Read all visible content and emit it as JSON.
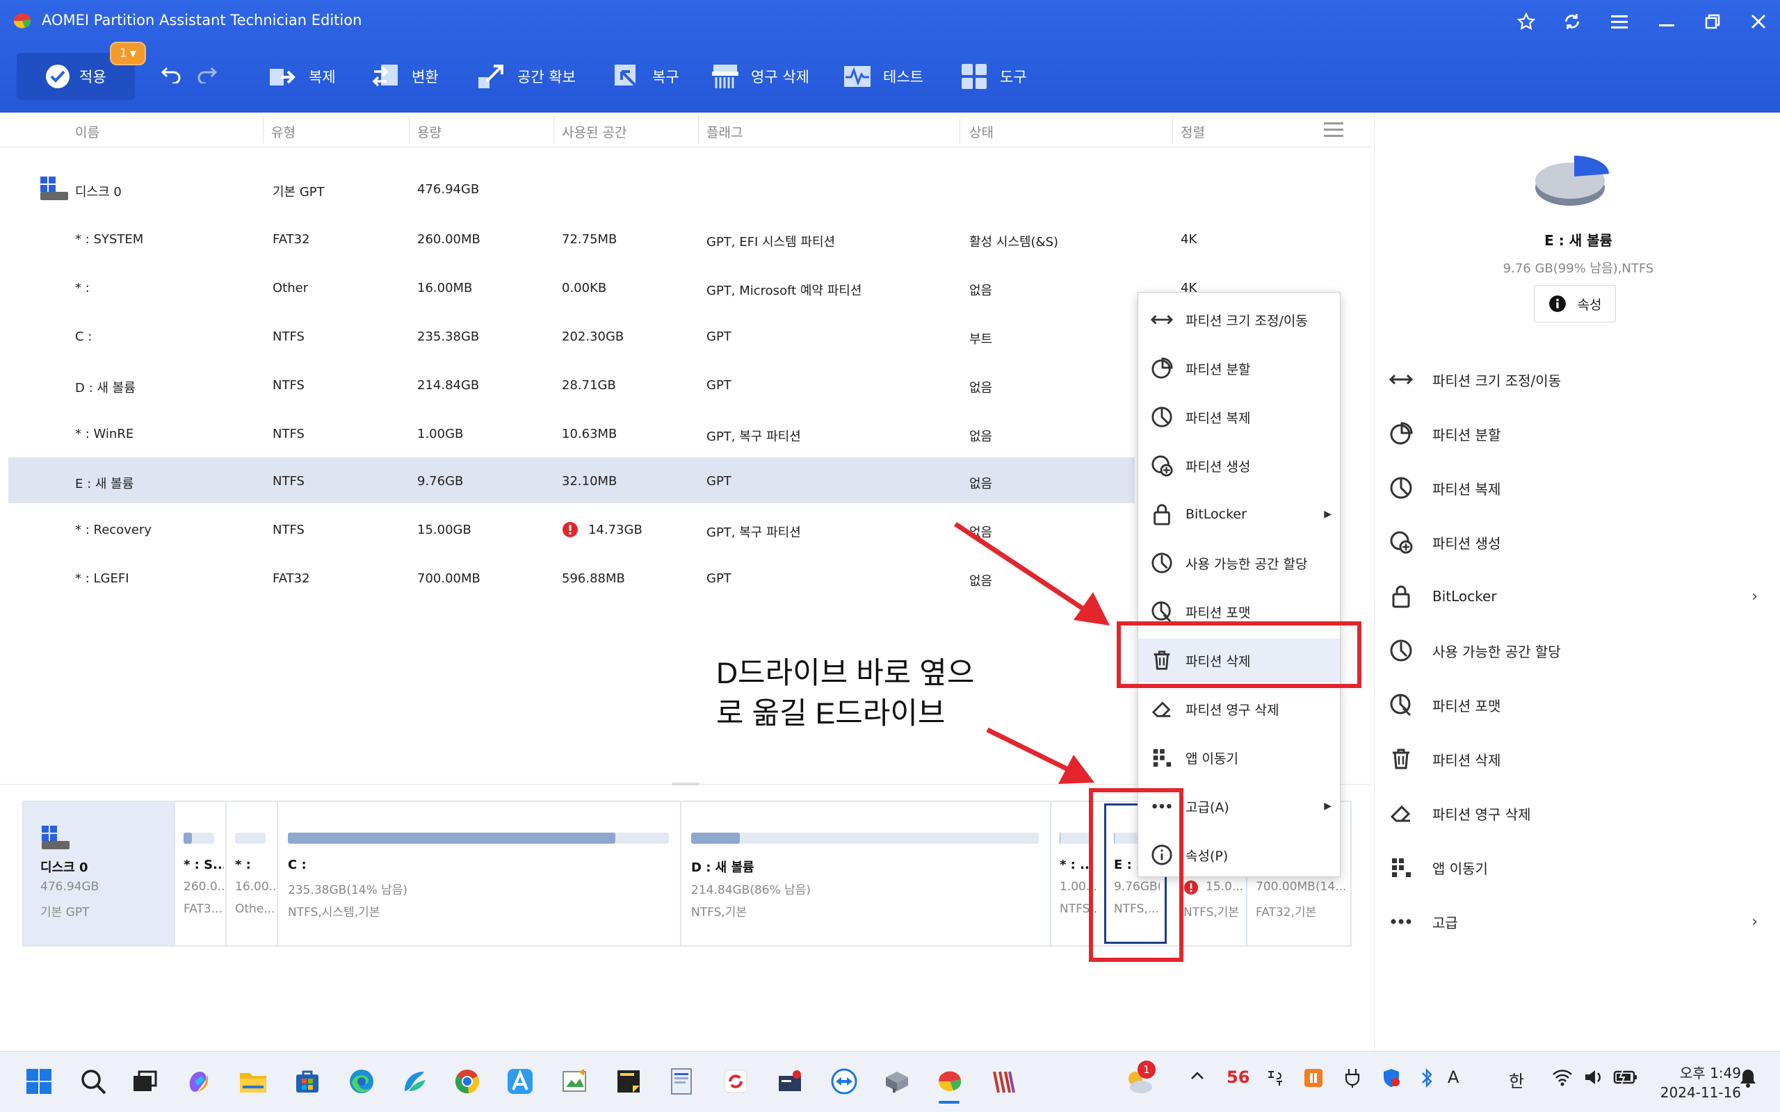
{
  "window": {
    "title": "AOMEI Partition Assistant Technician Edition"
  },
  "toolbar": {
    "apply_label": "적용",
    "apply_badge": "1",
    "items": [
      {
        "label": "복제"
      },
      {
        "label": "변환"
      },
      {
        "label": "공간 확보"
      },
      {
        "label": "복구"
      },
      {
        "label": "영구 삭제"
      },
      {
        "label": "테스트"
      },
      {
        "label": "도구"
      }
    ]
  },
  "table": {
    "columns": [
      "이름",
      "유형",
      "용량",
      "사용된 공간",
      "플래그",
      "상태",
      "정렬"
    ],
    "disk": {
      "name": "디스크 0",
      "type": "기본 GPT",
      "capacity": "476.94GB"
    },
    "rows": [
      {
        "name": "* : SYSTEM",
        "type": "FAT32",
        "capacity": "260.00MB",
        "used": "72.75MB",
        "flag": "GPT, EFI 시스템 파티션",
        "status": "활성 시스템(&S)",
        "align": "4K"
      },
      {
        "name": "* :",
        "type": "Other",
        "capacity": "16.00MB",
        "used": "0.00KB",
        "flag": "GPT, Microsoft 예약 파티션",
        "status": "없음",
        "align": "4K"
      },
      {
        "name": "C :",
        "type": "NTFS",
        "capacity": "235.38GB",
        "used": "202.30GB",
        "flag": "GPT",
        "status": "부트",
        "align": ""
      },
      {
        "name": "D : 새 볼륨",
        "type": "NTFS",
        "capacity": "214.84GB",
        "used": "28.71GB",
        "flag": "GPT",
        "status": "없음",
        "align": ""
      },
      {
        "name": "* : WinRE",
        "type": "NTFS",
        "capacity": "1.00GB",
        "used": "10.63MB",
        "flag": "GPT, 복구 파티션",
        "status": "없음",
        "align": ""
      },
      {
        "name": "E : 새 볼륨",
        "type": "NTFS",
        "capacity": "9.76GB",
        "used": "32.10MB",
        "flag": "GPT",
        "status": "없음",
        "align": ""
      },
      {
        "name": "* : Recovery",
        "type": "NTFS",
        "capacity": "15.00GB",
        "used": "14.73GB",
        "flag": "GPT, 복구 파티션",
        "status": "없음",
        "align": ""
      },
      {
        "name": "* : LGEFI",
        "type": "FAT32",
        "capacity": "700.00MB",
        "used": "596.88MB",
        "flag": "GPT",
        "status": "없음",
        "align": ""
      }
    ]
  },
  "context_menu": {
    "items": [
      {
        "label": "파티션 크기 조정/이동"
      },
      {
        "label": "파티션 분할"
      },
      {
        "label": "파티션 복제"
      },
      {
        "label": "파티션 생성"
      },
      {
        "label": "BitLocker"
      },
      {
        "label": "사용 가능한 공간 할당"
      },
      {
        "label": "파티션 포맷"
      },
      {
        "label": "파티션 삭제"
      },
      {
        "label": "파티션 영구 삭제"
      },
      {
        "label": "앱 이동기"
      },
      {
        "label": "고급(A)"
      },
      {
        "label": "속성(P)"
      }
    ]
  },
  "right_panel": {
    "title": "E : 새 볼륨",
    "subtitle": "9.76 GB(99% 남음),NTFS",
    "props_button": "속성",
    "items": [
      {
        "label": "파티션 크기 조정/이동"
      },
      {
        "label": "파티션 분할"
      },
      {
        "label": "파티션 복제"
      },
      {
        "label": "파티션 생성"
      },
      {
        "label": "BitLocker"
      },
      {
        "label": "사용 가능한 공간 할당"
      },
      {
        "label": "파티션 포맷"
      },
      {
        "label": "파티션 삭제"
      },
      {
        "label": "파티션 영구 삭제"
      },
      {
        "label": "앱 이동기"
      },
      {
        "label": "고급"
      }
    ]
  },
  "disk_map": {
    "disk_name": "디스크 0",
    "disk_size": "476.94GB",
    "disk_type": "기본 GPT",
    "partitions": [
      {
        "name": "* : S...",
        "line1": "260.0...",
        "line2": "FAT3...",
        "used_fraction": 0.28
      },
      {
        "name": "* :",
        "line1": "16.00...",
        "line2": "Othe...",
        "used_fraction": 0.0
      },
      {
        "name": "C :",
        "line1": "235.38GB(14% 남음)",
        "line2": "NTFS,시스템,기본",
        "used_fraction": 0.86
      },
      {
        "name": "D : 새 볼륨",
        "line1": "214.84GB(86% 남음)",
        "line2": "NTFS,기본",
        "used_fraction": 0.14
      },
      {
        "name": "* : ...",
        "line1": "1.00...",
        "line2": "NTFS...",
        "used_fraction": 0.01
      },
      {
        "name": "E : ...",
        "line1": "9.76GB(...",
        "line2": "NTFS,...",
        "used_fraction": 0.01
      },
      {
        "name": "",
        "line1": "15.0...",
        "line2": "NTFS,기본",
        "used_fraction": 0.98
      },
      {
        "name": "",
        "line1": "700.00MB(14...",
        "line2": "FAT32,기본",
        "used_fraction": 0.85
      }
    ]
  },
  "annotation": {
    "text": "D드라이브 바로 옆으로 옮길 E드라이브"
  },
  "taskbar": {
    "tray_number": "56",
    "tray_lang_a": "A",
    "tray_lang_han": "한",
    "time_period": "오후",
    "time": "1:49",
    "date": "2024-11-16",
    "badge": "1"
  },
  "colors": {
    "accent": "#2a5fe0",
    "selection": "#dde5f3",
    "annotation_red": "#e3262c",
    "badge_orange": "#f49a2c"
  }
}
